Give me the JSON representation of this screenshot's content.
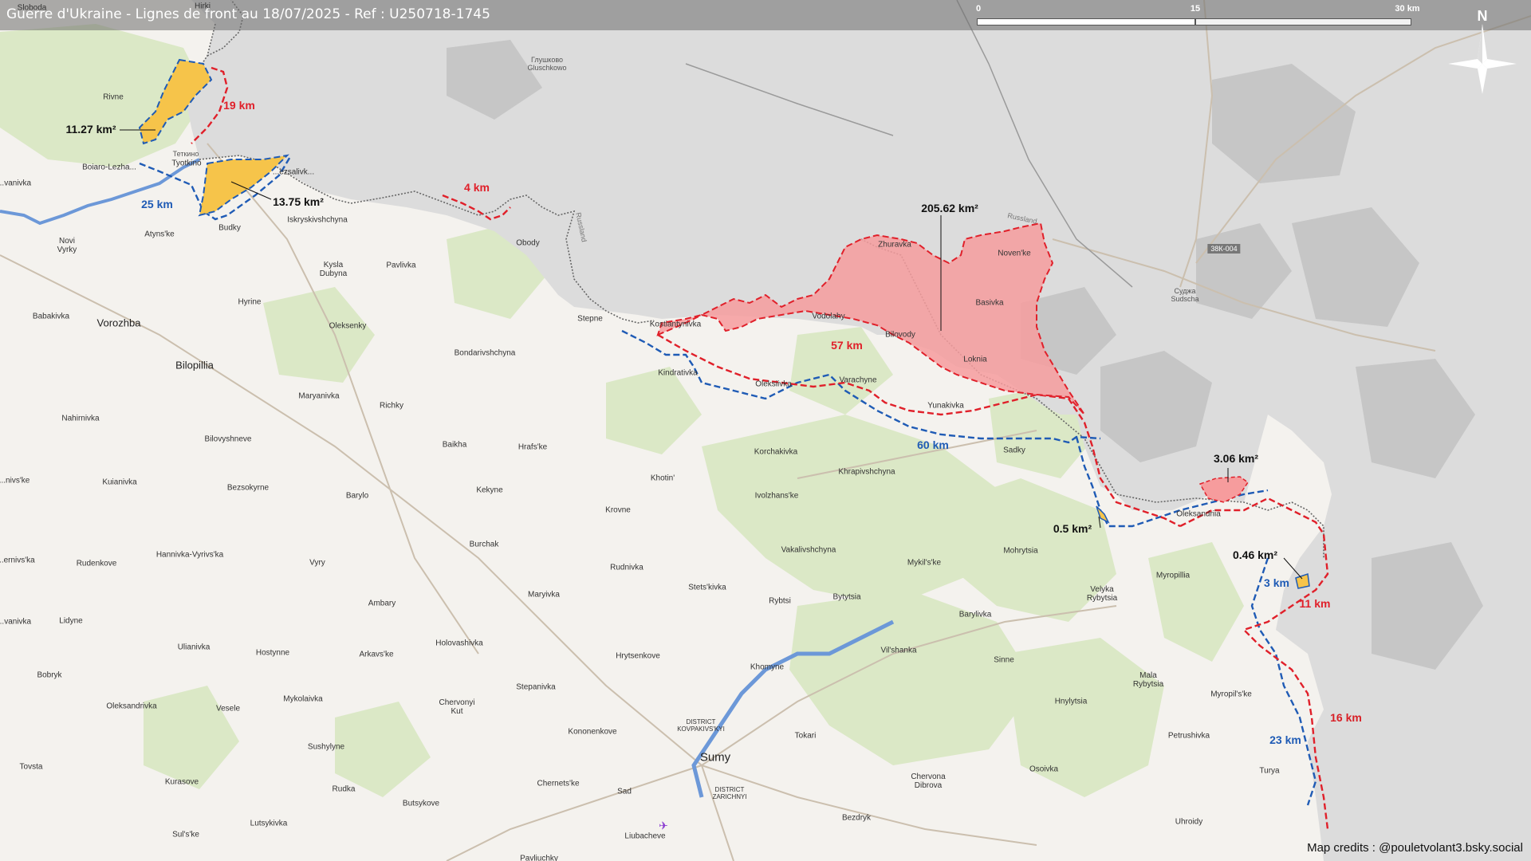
{
  "title": "Guerre d'Ukraine - Lignes de front au 18/07/2025 - Ref : U250718-1745",
  "credits": "Map credits : @pouletvolant3.bsky.social",
  "scale_bar": {
    "labels": [
      "0",
      "15",
      "30 km"
    ]
  },
  "compass": {
    "label": "N",
    "icon": "compass-rose-icon"
  },
  "colors": {
    "occupied_fill": "#f69c9d",
    "contested_fill": "#f6c44a",
    "red_line": "#e0202a",
    "blue_line": "#1f5bb5",
    "border_line": "#666666",
    "russia_tint": "#dcdcdc",
    "forest": "#d9e8c4",
    "river": "#5f8fd6"
  },
  "areas": {
    "a1": "11.27 km²",
    "a2": "13.75 km²",
    "a3": "205.62 km²",
    "a4": "3.06 km²",
    "a5": "0.5 km²",
    "a6": "0.46 km²"
  },
  "distances": {
    "d1": "19 km",
    "d2": "25 km",
    "d3": "4 km",
    "d4": "57 km",
    "d5": "60 km",
    "d6": "3 km",
    "d7": "11 km",
    "d8": "16 km",
    "d9": "23 km"
  },
  "places": {
    "sloboda": "Sloboda",
    "hirki": "Hirki",
    "rivne": "Rivne",
    "tetkino_ru": "Теткино",
    "tetkino": "Tyotkino",
    "boiaro": "Boiaro-Lezha...",
    "vanivka": "...vanivka",
    "bezsalivka": "...ezsalivk...",
    "budky": "Budky",
    "atyns_ke": "Atyns'ke",
    "novi_vyrky": "Novi\nVyrky",
    "iskryskivshchyna": "Iskryskivshchyna",
    "glushkovo": "Глушково\nGluschkowo",
    "obody": "Obody",
    "kysla_dubyna": "Kysla\nDubyna",
    "pavlivka": "Pavlivka",
    "babakivka": "Babakivka",
    "vorozhba": "Vorozhba",
    "hyrine": "Hyrine",
    "oleksenky": "Oleksenky",
    "stepne": "Stepne",
    "kostiantynivka": "Kostiantynivka",
    "bilopillia": "Bilopillia",
    "bondarivshchyna": "Bondarivshchyna",
    "kindrativka": "Kindratіvka",
    "oleksiivka": "Oleksiivka",
    "varachyne": "Varachyne",
    "maryanivka": "Maryanivka",
    "richky": "Richky",
    "nahirnivka": "Nahirnivka",
    "zhuravka": "Zhuravka",
    "vodolahy": "Vodolahy",
    "bilovody": "Bilovody",
    "noven_ke": "Noven'ke",
    "basivka": "Basivka",
    "loknia": "Loknia",
    "yunakivka": "Yunakivka",
    "suzha_ru": "Суджа\nSudscha",
    "road_38k": "38К-004",
    "bilovyshneve": "Bilovyshneve",
    "baikha": "Baikha",
    "hrafs_ke": "Hrafs'ke",
    "korchakivka": "Korchakivka",
    "khrapivshchyna": "Khrapivshchyna",
    "sadky": "Sadky",
    "kuianivka": "Kuianivka",
    "bezsokyrne": "Bezsokyrne",
    "barylo": "Barylo",
    "kekyne": "Kekyne",
    "khotin": "Khotin'",
    "ivolzhans_ke": "Ivolzhans'ke",
    "krovne": "Krovne",
    "oleksandriia": "Oleksandriia",
    "ernivs_ka": "...ernivs'ka",
    "nivs_ke": "...nivs'ke",
    "burchak": "Burchak",
    "vakalivshchyna": "Vakalivshchyna",
    "mohrytsia": "Mohrytsia",
    "rudenkove": "Rudenkove",
    "hannivka": "Hannivka-Vyrivs'ka",
    "vyry": "Vyry",
    "rudnivka": "Rudnivka",
    "mykil_s_ke": "Mykil's'ke",
    "myropillia": "Myropillia",
    "vanivka2": "...vanivka",
    "maryivka": "Maryivka",
    "stets_kivka": "Stets'kivka",
    "rybtsi": "Rybtsi",
    "bytytsia": "Bytytsia",
    "velyka_rybytsia": "Velyka\nRybytsia",
    "lidyne": "Lidyne",
    "ambary": "Ambary",
    "barylivka": "Barylivka",
    "ulianivka": "Ulianivka",
    "hostynne": "Hostynne",
    "arkavs_ke": "Arkavs'ke",
    "holovashivka": "Holovashivka",
    "hrytsenkove": "Hrytsenkove",
    "vil_shanka": "Vil'shanka",
    "bobryk": "Bobryk",
    "khomyne": "Khomyne",
    "sinne": "Sinne",
    "mala_rybytsia": "Mala\nRybytsia",
    "stepanivka": "Stepanivka",
    "oleksandrivka": "Oleksandrivka",
    "mykolaivka": "Mykolaivka",
    "chervonyi_kut": "Chervonyi\nKut",
    "vesele": "Vesele",
    "kononenkove": "Kononenkove",
    "hnylytsia": "Hnylytsia",
    "myropil_s_ke": "Myropil's'ke",
    "district_kovpakivskyi": "DISTRICT\nKOVPAKIVS'KYI",
    "sumy": "Sumy",
    "tokari": "Tokari",
    "sushylyne": "Sushylyne",
    "petrushivka": "Petrushivka",
    "tovsta": "Tovsta",
    "chervona_dibrova": "Chervona\nDibrova",
    "osoivka": "Osoivka",
    "turya": "Turya",
    "kurasove": "Kurasove",
    "rudka": "Rudka",
    "chernets_ke": "Chernets'ke",
    "district_zarichnyi": "DISTRICT\nZARICHNYI",
    "sad": "Sad",
    "butsykove": "Butsykove",
    "bezdryk": "Bezdryk",
    "lutsykivka": "Lutsykivka",
    "uhroidy": "Uhroidy",
    "sul_s_ke": "Sul's'ke",
    "liubacheve": "Liubacheve",
    "pavliuchky": "Pavliuchky",
    "russland": "Russland",
    "russland2": "Russland"
  }
}
